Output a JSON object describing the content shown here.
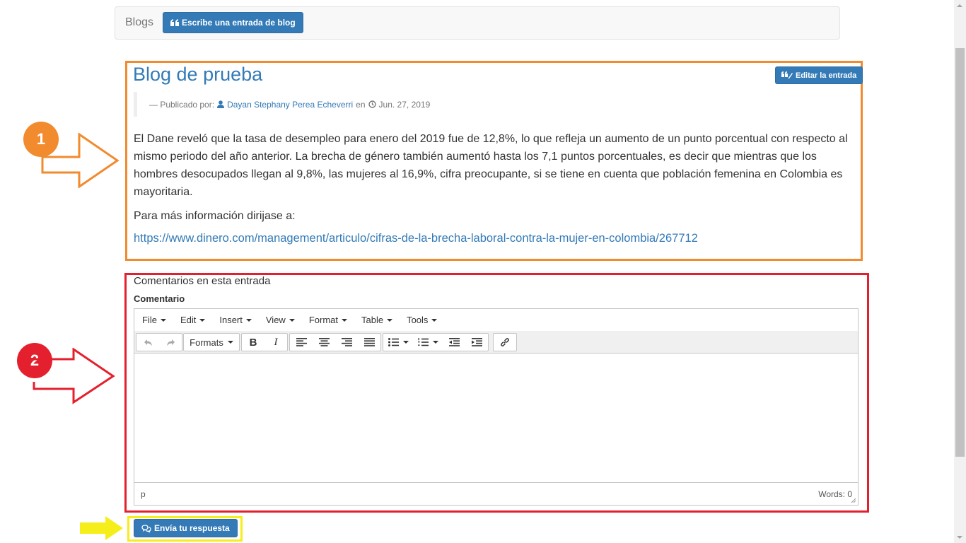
{
  "nav": {
    "brand": "Blogs",
    "write_button": "Escribe una entrada de blog",
    "write_icon": "quote-icon"
  },
  "post": {
    "title": "Blog de prueba",
    "edit_button": "Editar la entrada",
    "meta": {
      "prefix": "— Publicado por:",
      "author": "Dayan Stephany Perea Echeverri",
      "connector": "en",
      "date": "Jun. 27, 2019"
    },
    "body": "El Dane reveló que la tasa de desempleo para enero del 2019 fue de 12,8%, lo que refleja un aumento de un punto porcentual con respecto al mismo periodo del año anterior. La brecha de género también aumentó hasta los 7,1 puntos porcentuales, es decir que mientras que los hombres desocupados llegan al 9,8%, las mujeres al 16,9%, cifra preocupante, si se tiene en cuenta que población femenina en Colombia es mayoritaria.",
    "more_info": "Para más información dirijase a:",
    "link": "https://www.dinero.com/management/articulo/cifras-de-la-brecha-laboral-contra-la-mujer-en-colombia/267712"
  },
  "comments": {
    "title": "Comentarios en esta entrada",
    "label": "Comentario",
    "editor": {
      "menus": [
        "File",
        "Edit",
        "Insert",
        "View",
        "Format",
        "Table",
        "Tools"
      ],
      "formats_label": "Formats",
      "bold": "B",
      "italic": "I",
      "status_path": "p",
      "word_count": "Words: 0"
    },
    "submit_button": "Envía tu respuesta"
  },
  "annotations": {
    "badge1": "1",
    "badge2": "2",
    "colors": {
      "orange": "#f28a2e",
      "red": "#e5202e",
      "yellow": "#f5ee1b"
    }
  },
  "colors": {
    "primary": "#337ab7",
    "text": "#333333",
    "muted": "#777777"
  }
}
